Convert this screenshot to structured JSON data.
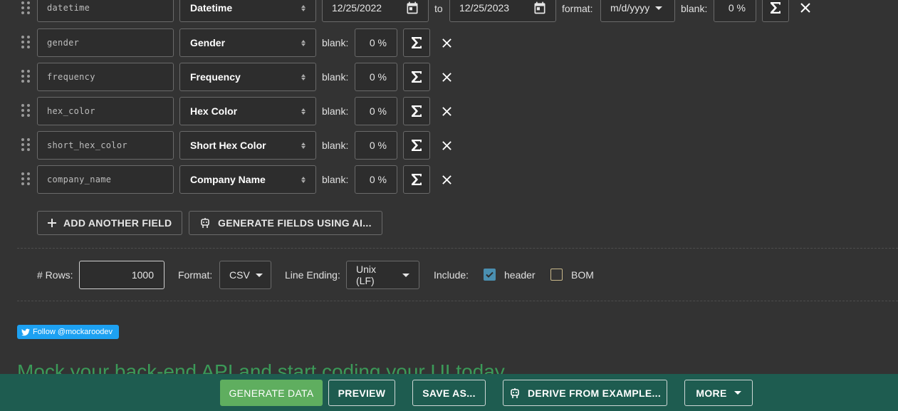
{
  "fields": [
    {
      "name": "datetime",
      "type": "Datetime",
      "blank": "0 %"
    },
    {
      "name": "gender",
      "type": "Gender",
      "blank": "0 %"
    },
    {
      "name": "frequency",
      "type": "Frequency",
      "blank": "0 %"
    },
    {
      "name": "hex_color",
      "type": "Hex Color",
      "blank": "0 %"
    },
    {
      "name": "short_hex_color",
      "type": "Short Hex Color",
      "blank": "0 %"
    },
    {
      "name": "company_name",
      "type": "Company Name",
      "blank": "0 %"
    }
  ],
  "datetime_options": {
    "from": "12/25/2022",
    "to_label": "to",
    "to": "12/25/2023",
    "format_label": "format:",
    "format": "m/d/yyyy"
  },
  "labels": {
    "blank": "blank:"
  },
  "actions": {
    "add_field": "ADD ANOTHER FIELD",
    "generate_ai": "GENERATE FIELDS USING AI..."
  },
  "options": {
    "rows_label": "# Rows:",
    "rows_value": "1000",
    "format_label": "Format:",
    "format_value": "CSV",
    "line_ending_label": "Line Ending:",
    "line_ending_value": "Unix (LF)",
    "include_label": "Include:",
    "header_label": "header",
    "header_checked": true,
    "bom_label": "BOM",
    "bom_checked": false
  },
  "social": {
    "twitter_follow": "Follow @mockaroodev"
  },
  "promo": {
    "headline": "Mock your back-end API and start coding your UI today."
  },
  "footer": {
    "generate": "GENERATE DATA",
    "preview": "PREVIEW",
    "save_as": "SAVE AS...",
    "derive": "DERIVE FROM EXAMPLE...",
    "more": "MORE"
  },
  "colors": {
    "background": "#333333",
    "footer": "#1e5c50",
    "primary_button": "#5fae5f",
    "twitter": "#1da1f2",
    "promo_text": "#3b9a58"
  },
  "icons": [
    "drag-handle-icon",
    "updown-icon",
    "calendar-icon",
    "sigma-icon",
    "close-icon",
    "plus-icon",
    "robot-icon",
    "caret-down-icon",
    "twitter-bird-icon",
    "checkbox-icon"
  ]
}
